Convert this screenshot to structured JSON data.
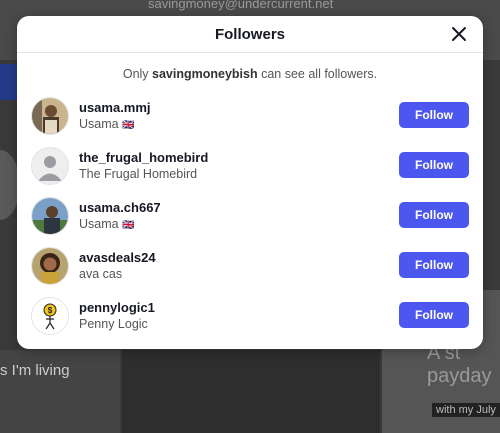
{
  "background": {
    "email": "savingmoney@undercurrent.net",
    "text_left": "s I'm living",
    "text_right": "A st\npayday",
    "tag_right": "with my July"
  },
  "modal": {
    "title": "Followers",
    "notice_prefix": "Only ",
    "notice_user": "savingmoneybish",
    "notice_suffix": " can see all followers.",
    "follow_label": "Follow"
  },
  "followers": [
    {
      "username": "usama.mmj",
      "nickname": "Usama",
      "flag": "🇬🇧",
      "avatar": "photo-man-portrait"
    },
    {
      "username": "the_frugal_homebird",
      "nickname": "The Frugal Homebird",
      "flag": "",
      "avatar": "default-person-icon"
    },
    {
      "username": "usama.ch667",
      "nickname": "Usama",
      "flag": "🇬🇧",
      "avatar": "photo-man-outdoors"
    },
    {
      "username": "avasdeals24",
      "nickname": "ava cas",
      "flag": "",
      "avatar": "photo-woman-smiling"
    },
    {
      "username": "pennylogic1",
      "nickname": "Penny Logic",
      "flag": "",
      "avatar": "dollar-coin-figure-logo"
    }
  ],
  "colors": {
    "accent": "#4b57ee",
    "text": "#161823",
    "muted": "#555555"
  }
}
